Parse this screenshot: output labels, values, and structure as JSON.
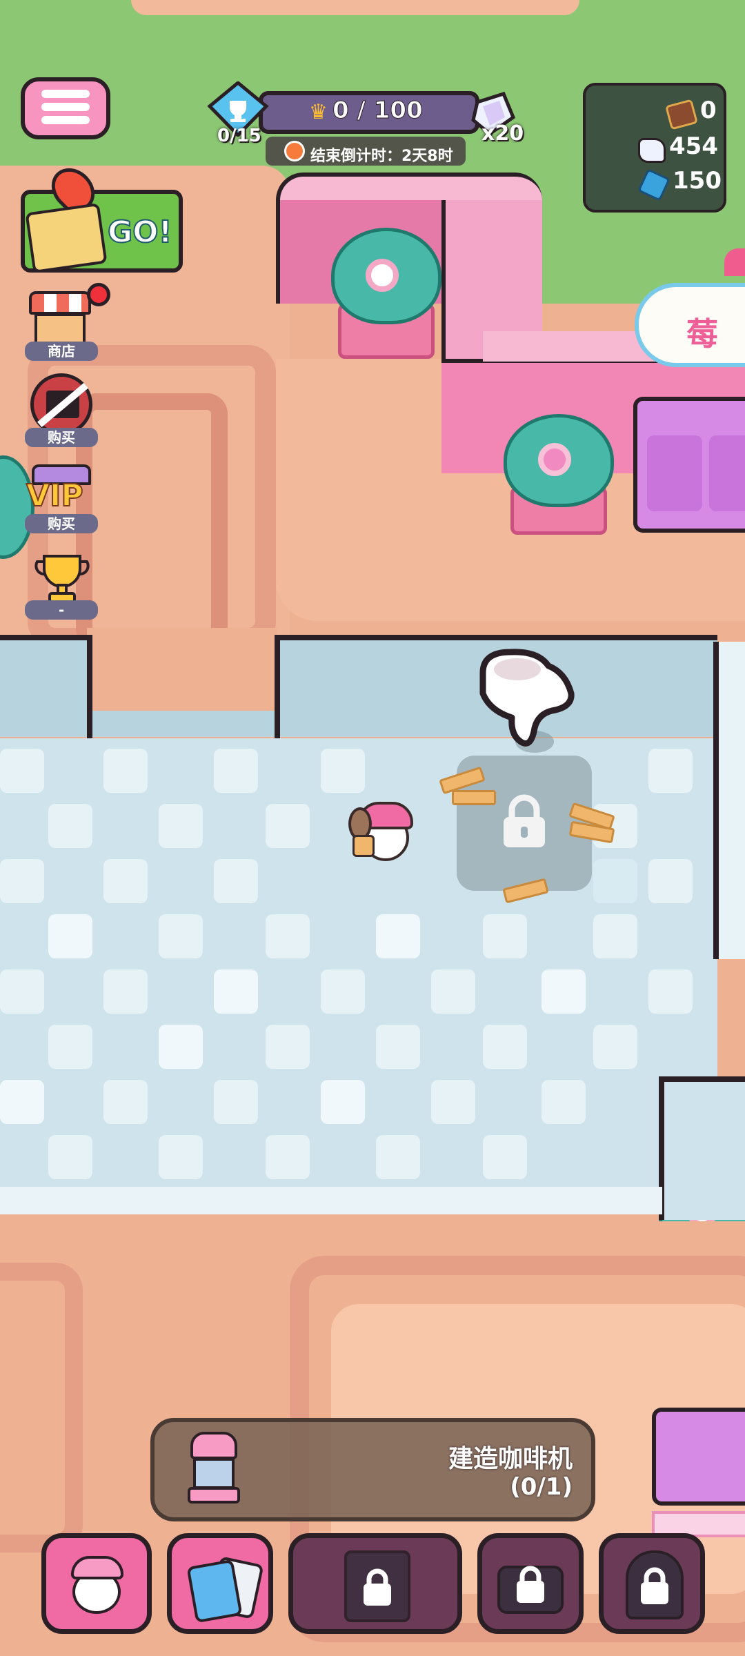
{
  "event": {
    "trophy_progress": "0/15",
    "crown_score": "0 / 100",
    "countdown": "结束倒计时：2天8时",
    "gem_multiplier": "x20"
  },
  "resources": {
    "chocolate": "0",
    "crystal": "454",
    "blue_gem": "150"
  },
  "side_menu": {
    "go_label": "GO!",
    "shop_label": "商店",
    "buy_label": "购买",
    "vip_text": "VIP",
    "vip_label": "购买",
    "trophy_label": "-"
  },
  "shop_sign": "莓",
  "task": {
    "title": "建造咖啡机",
    "progress": "(0/1)"
  },
  "colors": {
    "pink_wall": "#f4a6c9",
    "floor_light": "#cfe3ec",
    "terracotta": "#eeb293",
    "grass": "#8cc873",
    "hud_dark": "#3e5241"
  }
}
